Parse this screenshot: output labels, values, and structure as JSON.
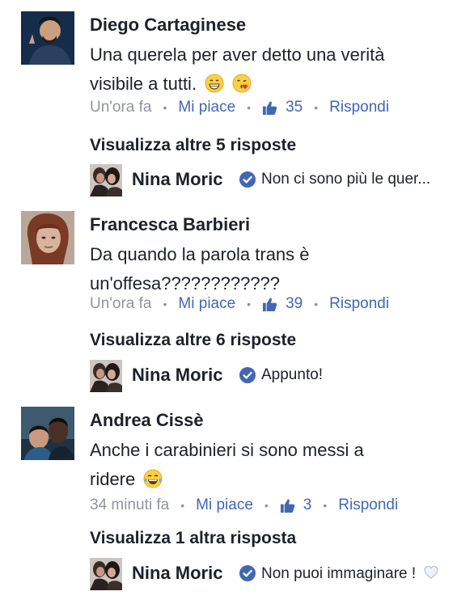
{
  "comments": [
    {
      "author": "Diego Cartaginese",
      "text_line1": "Una querela per aver detto una verità",
      "text_line2": "visibile a tutti.",
      "time": "Un'ora fa",
      "like_label": "Mi piace",
      "likes": "35",
      "reply_label": "Rispondi",
      "more_replies": "Visualizza altre 5 risposte",
      "reply": {
        "author": "Nina Moric",
        "text": "Non ci sono più le quer..."
      }
    },
    {
      "author": "Francesca Barbieri",
      "text_line1": "Da quando la parola trans è",
      "text_line2": "un'offesa????????????",
      "time": "Un'ora fa",
      "like_label": "Mi piace",
      "likes": "39",
      "reply_label": "Rispondi",
      "more_replies": "Visualizza altre 6 risposte",
      "reply": {
        "author": "Nina Moric",
        "text": "Appunto!"
      }
    },
    {
      "author": "Andrea Cissè",
      "text_line1": "Anche i carabinieri si sono messi a",
      "text_line2": "ridere",
      "time": "34 minuti fa",
      "like_label": "Mi piace",
      "likes": "3",
      "reply_label": "Rispondi",
      "more_replies": "Visualizza 1 altra risposta",
      "reply": {
        "author": "Nina Moric",
        "text": "Non puoi immaginare !"
      }
    }
  ],
  "colors": {
    "link_blue": "#4267b2",
    "meta_grey": "#90949c",
    "text_dark": "#1d2129",
    "verified_blue": "#4267b2"
  },
  "icons": {
    "like": "thumbs-up-icon",
    "verified": "verified-check-icon",
    "emoji_1": "grinning-face-icon",
    "emoji_2": "face-blowing-kiss-icon",
    "emoji_3": "tears-of-joy-icon",
    "emoji_4": "white-heart-icon"
  }
}
